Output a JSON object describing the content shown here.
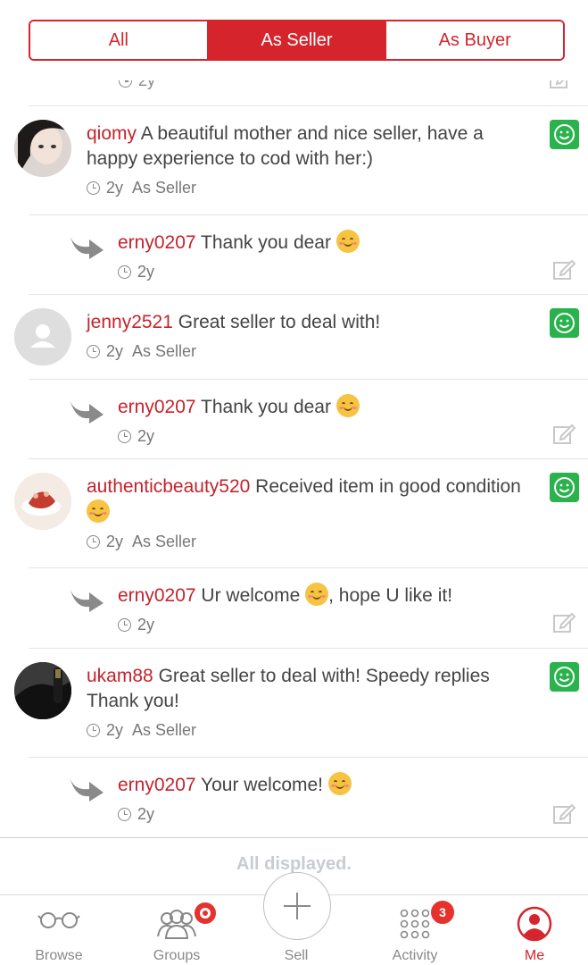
{
  "segments": {
    "all": "All",
    "as_seller": "As Seller",
    "as_buyer": "As Buyer"
  },
  "partial_item": {
    "time": "2y"
  },
  "reviews": [
    {
      "username": "qiomy",
      "text": "A beautiful mother and nice seller, have a happy experience to cod with her:)",
      "time": "2y",
      "role": "As Seller",
      "reply": {
        "username": "erny0207",
        "text": "Thank you dear",
        "time": "2y"
      }
    },
    {
      "username": "jenny2521",
      "text": "Great seller to deal with!",
      "time": "2y",
      "role": "As Seller",
      "reply": {
        "username": "erny0207",
        "text": "Thank you dear",
        "time": "2y"
      }
    },
    {
      "username": "authenticbeauty520",
      "text": "Received item in good condition",
      "time": "2y",
      "role": "As Seller",
      "reply": {
        "username": "erny0207",
        "text_before": "Ur welcome",
        "text_after": ", hope U like it!",
        "time": "2y"
      }
    },
    {
      "username": "ukam88",
      "text": "Great seller to deal with!  Speedy replies Thank you!",
      "time": "2y",
      "role": "As Seller",
      "reply": {
        "username": "erny0207",
        "text": "Your welcome!",
        "time": "2y"
      }
    }
  ],
  "footer_text": "All displayed.",
  "tabbar": {
    "browse": "Browse",
    "groups": "Groups",
    "sell": "Sell",
    "activity": "Activity",
    "activity_badge": "3",
    "me": "Me"
  },
  "colors": {
    "accent": "#d6242c",
    "positive": "#2ab24c",
    "muted": "#888888"
  }
}
